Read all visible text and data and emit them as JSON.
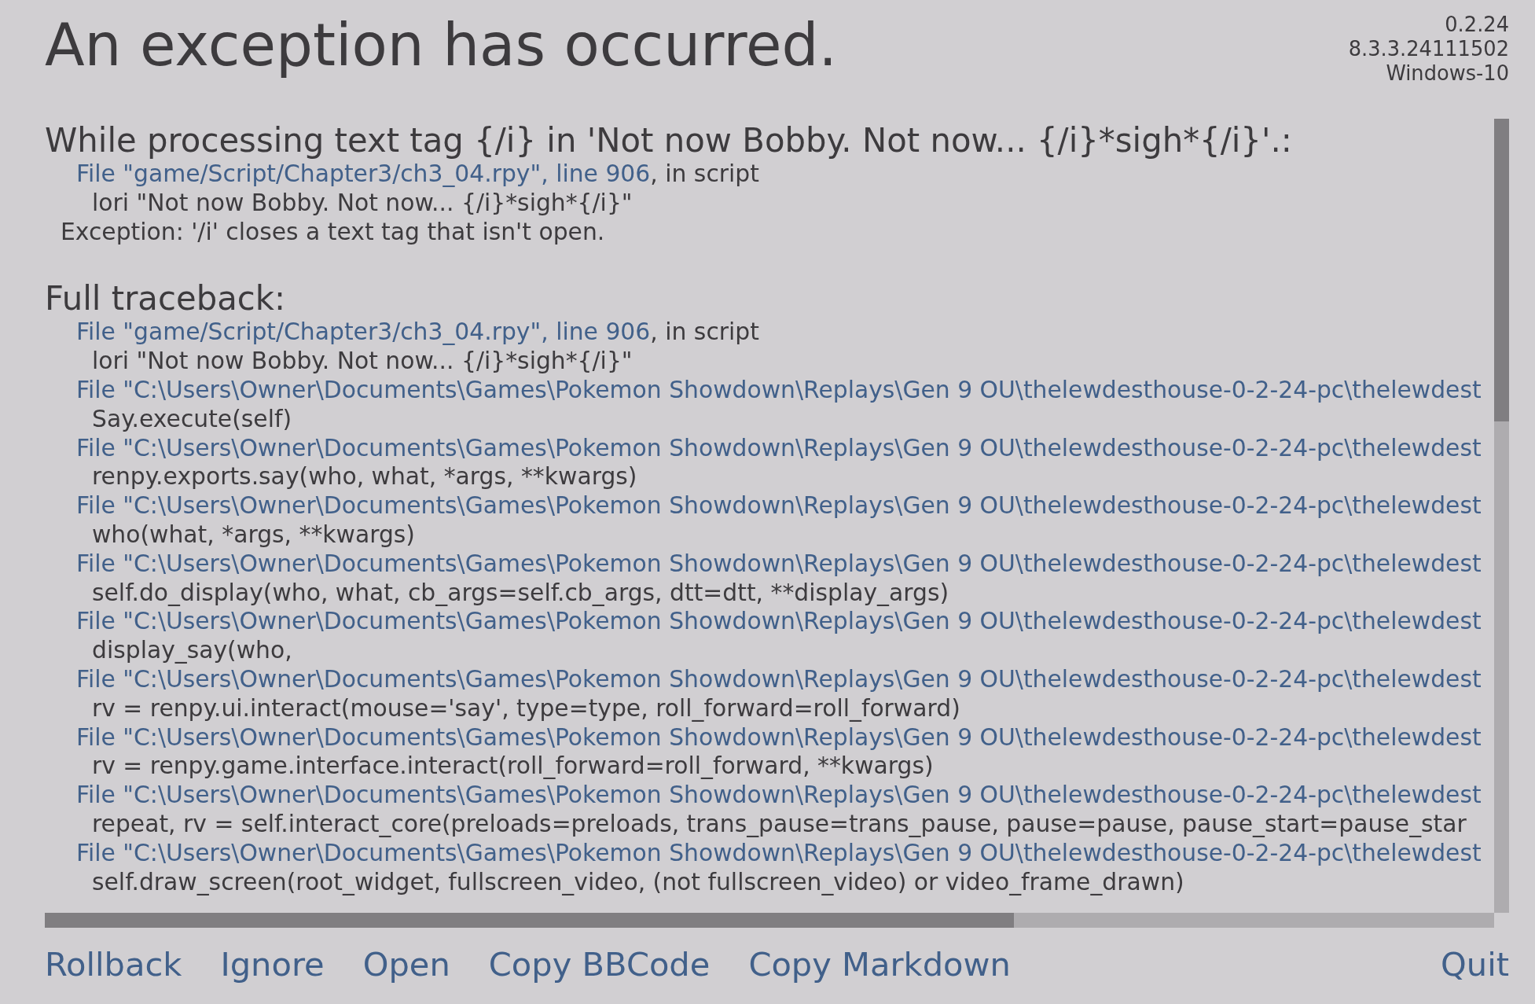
{
  "version_info": [
    "0.2.24",
    "8.3.3.24111502",
    "Windows-10"
  ],
  "title": "An exception has occurred.",
  "exception": {
    "heading": "While processing text tag {/i} in 'Not now Bobby. Not now... {/i}*sigh*{/i}'.:",
    "lines": [
      {
        "kind": "file",
        "link": "File \"game/Script/Chapter3/ch3_04.rpy\", line 906",
        "rest": ", in script"
      },
      {
        "kind": "code",
        "text": "lori \"Not now Bobby. Not now... {/i}*sigh*{/i}\""
      },
      {
        "kind": "message",
        "text": "Exception: '/i' closes a text tag that isn't open."
      }
    ]
  },
  "traceback": {
    "heading": "Full traceback:",
    "lines": [
      {
        "kind": "file",
        "link": "File \"game/Script/Chapter3/ch3_04.rpy\", line 906",
        "rest": ", in script"
      },
      {
        "kind": "code",
        "text": "lori \"Not now Bobby. Not now... {/i}*sigh*{/i}\""
      },
      {
        "kind": "file",
        "link": "File \"C:\\Users\\Owner\\Documents\\Games\\Pokemon Showdown\\Replays\\Gen 9 OU\\thelewdesthouse-0-2-24-pc\\thelewdest"
      },
      {
        "kind": "code",
        "text": "Say.execute(self)"
      },
      {
        "kind": "file",
        "link": "File \"C:\\Users\\Owner\\Documents\\Games\\Pokemon Showdown\\Replays\\Gen 9 OU\\thelewdesthouse-0-2-24-pc\\thelewdest"
      },
      {
        "kind": "code",
        "text": "renpy.exports.say(who, what, *args, **kwargs)"
      },
      {
        "kind": "file",
        "link": "File \"C:\\Users\\Owner\\Documents\\Games\\Pokemon Showdown\\Replays\\Gen 9 OU\\thelewdesthouse-0-2-24-pc\\thelewdest"
      },
      {
        "kind": "code",
        "text": "who(what, *args, **kwargs)"
      },
      {
        "kind": "file",
        "link": "File \"C:\\Users\\Owner\\Documents\\Games\\Pokemon Showdown\\Replays\\Gen 9 OU\\thelewdesthouse-0-2-24-pc\\thelewdest"
      },
      {
        "kind": "code",
        "text": "self.do_display(who, what, cb_args=self.cb_args, dtt=dtt, **display_args)"
      },
      {
        "kind": "file",
        "link": "File \"C:\\Users\\Owner\\Documents\\Games\\Pokemon Showdown\\Replays\\Gen 9 OU\\thelewdesthouse-0-2-24-pc\\thelewdest"
      },
      {
        "kind": "code",
        "text": "display_say(who,"
      },
      {
        "kind": "file",
        "link": "File \"C:\\Users\\Owner\\Documents\\Games\\Pokemon Showdown\\Replays\\Gen 9 OU\\thelewdesthouse-0-2-24-pc\\thelewdest"
      },
      {
        "kind": "code",
        "text": "rv = renpy.ui.interact(mouse='say', type=type, roll_forward=roll_forward)"
      },
      {
        "kind": "file",
        "link": "File \"C:\\Users\\Owner\\Documents\\Games\\Pokemon Showdown\\Replays\\Gen 9 OU\\thelewdesthouse-0-2-24-pc\\thelewdest"
      },
      {
        "kind": "code",
        "text": "rv = renpy.game.interface.interact(roll_forward=roll_forward, **kwargs)"
      },
      {
        "kind": "file",
        "link": "File \"C:\\Users\\Owner\\Documents\\Games\\Pokemon Showdown\\Replays\\Gen 9 OU\\thelewdesthouse-0-2-24-pc\\thelewdest"
      },
      {
        "kind": "code",
        "text": "repeat, rv = self.interact_core(preloads=preloads, trans_pause=trans_pause, pause=pause, pause_start=pause_star"
      },
      {
        "kind": "file",
        "link": "File \"C:\\Users\\Owner\\Documents\\Games\\Pokemon Showdown\\Replays\\Gen 9 OU\\thelewdesthouse-0-2-24-pc\\thelewdest"
      },
      {
        "kind": "code",
        "text": "self.draw_screen(root_widget, fullscreen_video, (not fullscreen_video) or video_frame_drawn)"
      }
    ]
  },
  "buttons": [
    "Rollback",
    "Ignore",
    "Open",
    "Copy BBCode",
    "Copy Markdown"
  ],
  "quit": "Quit"
}
